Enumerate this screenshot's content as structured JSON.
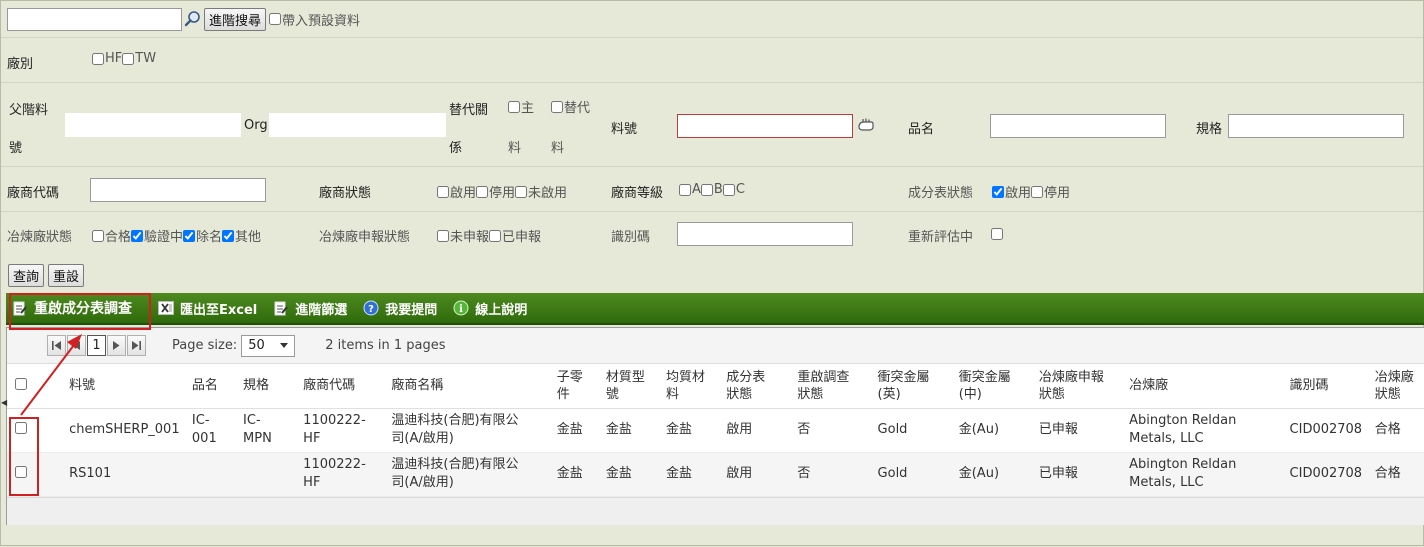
{
  "search": {
    "value": "",
    "button_label": "進階搜尋",
    "include_default_label": "帶入預設資料"
  },
  "form": {
    "factory": {
      "label": "廠別",
      "options": [
        "HF",
        "TW"
      ]
    },
    "parent_part": {
      "label_1": "父階料",
      "label_2": "號"
    },
    "org": {
      "label": "Org"
    },
    "replace_rel": {
      "label_1": "替代關",
      "label_2": "係",
      "opt1_a": "主",
      "opt1_b": "料",
      "opt2_a": "替代",
      "opt2_b": "料"
    },
    "part_no": {
      "label": "料號"
    },
    "item_name": {
      "label": "品名"
    },
    "spec": {
      "label": "規格"
    },
    "vendor_code": {
      "label": "廠商代碼"
    },
    "vendor_status": {
      "label": "廠商狀態",
      "options": [
        "啟用",
        "停用",
        "未啟用"
      ]
    },
    "vendor_level": {
      "label": "廠商等級",
      "options": [
        "A",
        "B",
        "C"
      ]
    },
    "composition_status": {
      "label": "成分表狀態",
      "options": [
        {
          "label": "啟用",
          "checked": true
        },
        {
          "label": "停用",
          "checked": false
        }
      ]
    },
    "smelter_status": {
      "label": "冶煉廠狀態",
      "options": [
        {
          "label": "合格",
          "checked": false
        },
        {
          "label": "驗證中",
          "checked": true
        },
        {
          "label": "除名",
          "checked": true
        },
        {
          "label": "其他",
          "checked": true
        }
      ]
    },
    "smelter_declare": {
      "label": "冶煉廠申報狀態",
      "options": [
        "未申報",
        "已申報"
      ]
    },
    "ident_code": {
      "label": "識別碼"
    },
    "re_evaluate": {
      "label": "重新評估中"
    }
  },
  "buttons": {
    "query": "查詢",
    "reset": "重設"
  },
  "toolbar": {
    "restart_survey": "重啟成分表調查",
    "export_excel": "匯出至Excel",
    "advanced_filter": "進階篩選",
    "ask_question": "我要提問",
    "online_help": "線上說明"
  },
  "pager": {
    "current_page": "1",
    "page_size_label": "Page size:",
    "page_size": "50",
    "summary": "2 items in 1 pages"
  },
  "table": {
    "headers": {
      "part_no": "料號",
      "item_name": "品名",
      "spec": "規格",
      "vendor_code": "廠商代碼",
      "vendor_name": "廠商名稱",
      "sub_part_1": "子零",
      "sub_part_2": "件",
      "material_type_1": "材質型",
      "material_type_2": "號",
      "homogeneous_1": "均質材",
      "homogeneous_2": "料",
      "comp_status_1": "成分表",
      "comp_status_2": "狀態",
      "restart_status_1": "重啟調查",
      "restart_status_2": "狀態",
      "conflict_en_1": "衝突金屬",
      "conflict_en_2": "(英)",
      "conflict_cn_1": "衝突金屬",
      "conflict_cn_2": "(中)",
      "smelter_declare_1": "冶煉廠申報",
      "smelter_declare_2": "狀態",
      "smelter": "冶煉廠",
      "ident_code": "識別碼",
      "smelter_status_1": "冶煉廠",
      "smelter_status_2": "狀態"
    },
    "rows": [
      {
        "part_no": "chemSHERP_001",
        "item_name_1": "IC-",
        "item_name_2": "001",
        "spec_1": "IC-",
        "spec_2": "MPN",
        "vendor_code_1": "1100222-",
        "vendor_code_2": "HF",
        "vendor_name_1": "温迪科技(合肥)有限公",
        "vendor_name_2": "司(A/啟用)",
        "sub_part": "金盐",
        "material_type": "金盐",
        "homogeneous": "金盐",
        "comp_status": "啟用",
        "restart_status": "否",
        "conflict_en": "Gold",
        "conflict_cn": "金(Au)",
        "smelter_declare": "已申報",
        "smelter_1": "Abington Reldan",
        "smelter_2": "Metals, LLC",
        "ident_code": "CID002708",
        "smelter_status": "合格"
      },
      {
        "part_no": "RS101",
        "item_name_1": "",
        "item_name_2": "",
        "spec_1": "",
        "spec_2": "",
        "vendor_code_1": "1100222-",
        "vendor_code_2": "HF",
        "vendor_name_1": "温迪科技(合肥)有限公",
        "vendor_name_2": "司(A/啟用)",
        "sub_part": "金盐",
        "material_type": "金盐",
        "homogeneous": "金盐",
        "comp_status": "啟用",
        "restart_status": "否",
        "conflict_en": "Gold",
        "conflict_cn": "金(Au)",
        "smelter_declare": "已申報",
        "smelter_1": "Abington Reldan",
        "smelter_2": "Metals, LLC",
        "ident_code": "CID002708",
        "smelter_status": "合格"
      }
    ]
  },
  "colors": {
    "toolbar_green": "#3b7614",
    "annotation_red": "#d21f1f",
    "form_bg": "#e7e9d8"
  },
  "icons": [
    "search-icon",
    "hand-pick-icon",
    "edit-note-icon",
    "excel-icon",
    "filter-icon",
    "help-question-icon",
    "info-icon"
  ]
}
